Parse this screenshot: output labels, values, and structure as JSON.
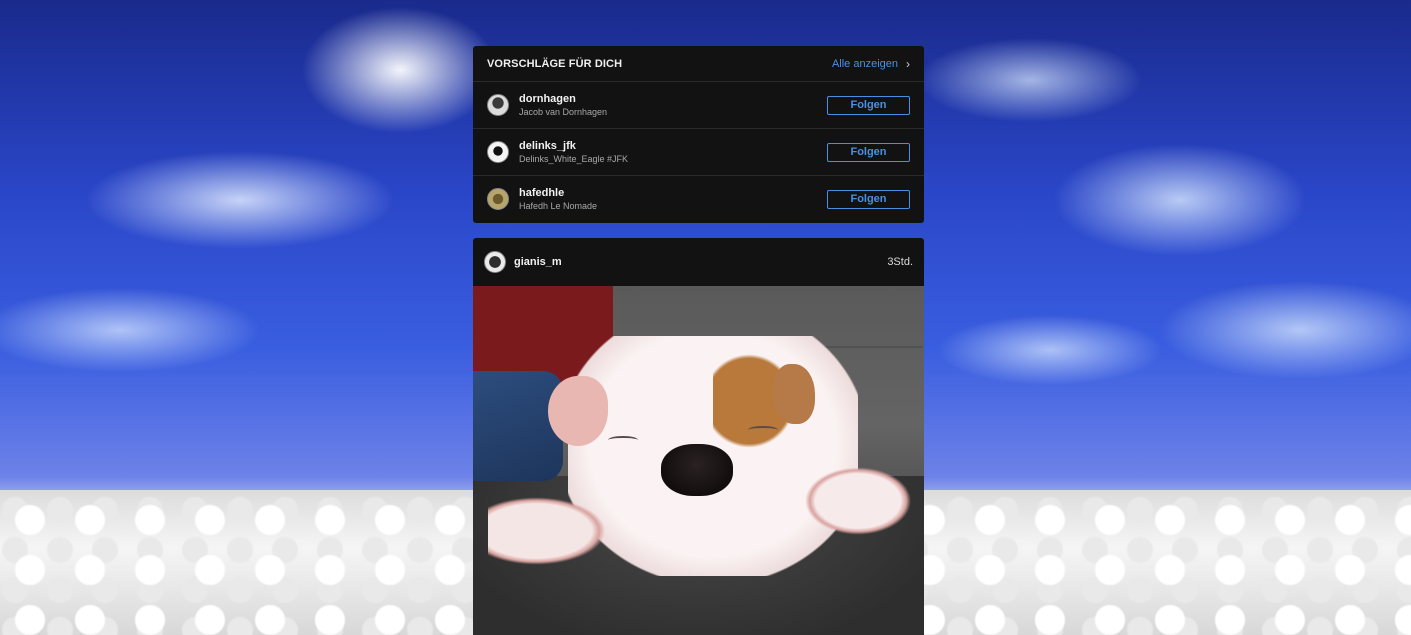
{
  "suggestions": {
    "title": "VORSCHLÄGE FÜR DICH",
    "see_all_label": "Alle anzeigen",
    "items": [
      {
        "username": "dornhagen",
        "full_name": "Jacob van Dornhagen",
        "follow_label": "Folgen"
      },
      {
        "username": "delinks_jfk",
        "full_name": "Delinks_White_Eagle #JFK",
        "follow_label": "Folgen"
      },
      {
        "username": "hafedhle",
        "full_name": "Hafedh Le Nomade",
        "follow_label": "Folgen"
      }
    ]
  },
  "post": {
    "username": "gianis_m",
    "time": "3Std."
  },
  "colors": {
    "accent": "#4a90e2",
    "panel": "#121212"
  }
}
